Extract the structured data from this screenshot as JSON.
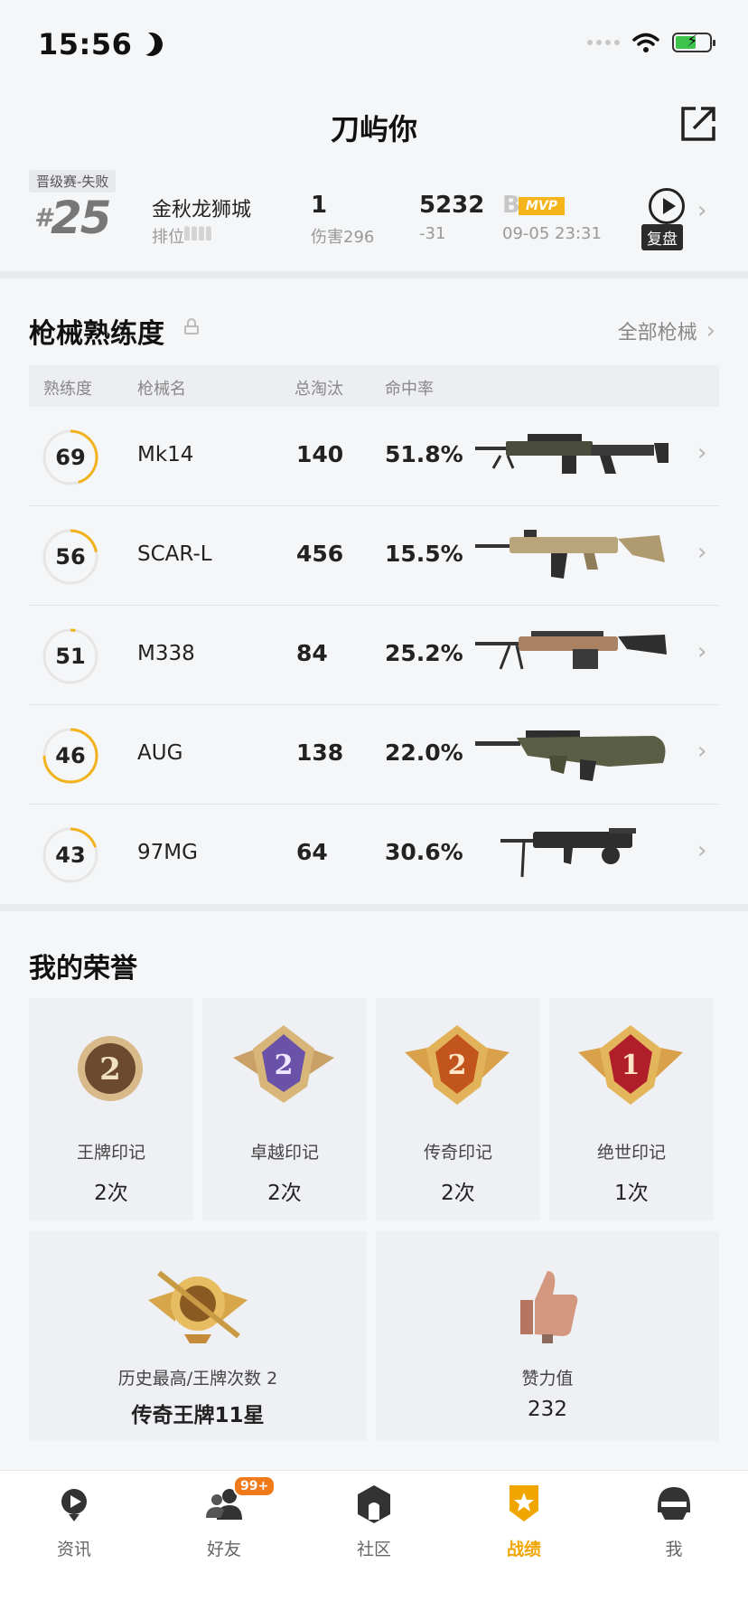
{
  "status_bar": {
    "time": "15:56"
  },
  "header": {
    "title": "刀屿你"
  },
  "recent_match": {
    "mode": "晋级赛-失败",
    "rank_prefix": "#",
    "rank": "25",
    "map": "金秋龙狮城",
    "position_label": "排位",
    "kills": "1",
    "damage": "伤害296",
    "score": "5232",
    "score_change": "-31",
    "tier": "B",
    "mvp": "MVP",
    "time": "09-05 23:31",
    "replay_label": "复盘"
  },
  "weapons_section": {
    "title": "枪械熟练度",
    "all_link": "全部枪械",
    "headers": {
      "mastery": "熟练度",
      "name": "枪械名",
      "kills": "总淘汰",
      "accuracy": "命中率"
    },
    "rows": [
      {
        "mastery": "69",
        "progress": 0.45,
        "name": "Mk14",
        "kills": "140",
        "accuracy": "51.8%"
      },
      {
        "mastery": "56",
        "progress": 0.22,
        "name": "SCAR-L",
        "kills": "456",
        "accuracy": "15.5%"
      },
      {
        "mastery": "51",
        "progress": 0.03,
        "name": "M338",
        "kills": "84",
        "accuracy": "25.2%"
      },
      {
        "mastery": "46",
        "progress": 0.75,
        "name": "AUG",
        "kills": "138",
        "accuracy": "22.0%"
      },
      {
        "mastery": "43",
        "progress": 0.2,
        "name": "97MG",
        "kills": "64",
        "accuracy": "30.6%"
      }
    ]
  },
  "honors_section": {
    "title": "我的荣誉",
    "badges": [
      {
        "numeral": "2",
        "name": "王牌印记",
        "count": "2次"
      },
      {
        "numeral": "2",
        "name": "卓越印记",
        "count": "2次"
      },
      {
        "numeral": "2",
        "name": "传奇印记",
        "count": "2次"
      },
      {
        "numeral": "1",
        "name": "绝世印记",
        "count": "1次"
      }
    ],
    "highest": {
      "label": "历史最高/王牌次数 2",
      "value": "传奇王牌11星"
    },
    "likes": {
      "label": "赞力值",
      "value": "232"
    }
  },
  "tabbar": {
    "friends_badge": "99+",
    "tabs": [
      {
        "label": "资讯",
        "icon": "news-icon"
      },
      {
        "label": "好友",
        "icon": "friends-icon"
      },
      {
        "label": "社区",
        "icon": "community-icon"
      },
      {
        "label": "战绩",
        "icon": "record-icon",
        "active": true
      },
      {
        "label": "我",
        "icon": "profile-helmet-icon"
      }
    ]
  },
  "colors": {
    "accent": "#f0a500",
    "ring": "#f2b21c",
    "mvp": "#f4b41a"
  }
}
